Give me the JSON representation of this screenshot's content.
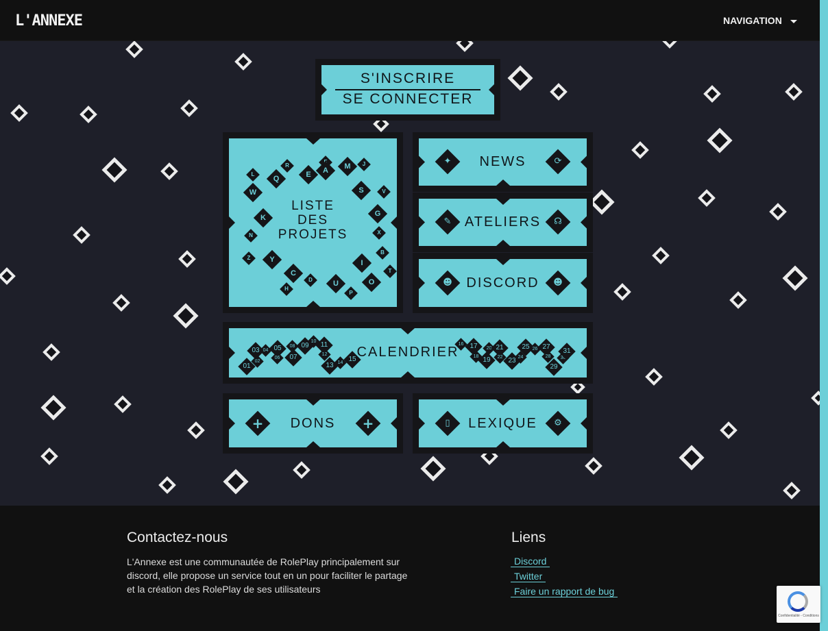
{
  "navbar": {
    "brand": "L'ANNEXE",
    "toggle_label": "NAVIGATION"
  },
  "auth": {
    "signup": "S'INSCRIRE",
    "login": "SE CONNECTER"
  },
  "tiles": {
    "projects": {
      "lines": [
        "LISTE",
        "DES",
        "PROJETS"
      ],
      "letters": [
        "L",
        "R",
        "F",
        "M",
        "J",
        "A",
        "Q",
        "E",
        "W",
        "S",
        "V",
        "K",
        "G",
        "N",
        "X",
        "Z",
        "Y",
        "B",
        "I",
        "T",
        "C",
        "D",
        "U",
        "O",
        "H",
        "P"
      ]
    },
    "news": {
      "label": "NEWS"
    },
    "ateliers": {
      "label": "ATELIERS"
    },
    "discord": {
      "label": "DISCORD"
    },
    "calendar": {
      "label": "CALENDRIER",
      "days": [
        "01",
        "02",
        "03",
        "04",
        "05",
        "06",
        "07",
        "08",
        "09",
        "10",
        "11",
        "12",
        "13",
        "14",
        "15",
        "16",
        "17",
        "18",
        "19",
        "20",
        "21",
        "22",
        "23",
        "24",
        "25",
        "26",
        "27",
        "28",
        "29",
        "30",
        "31"
      ]
    },
    "dons": {
      "label": "DONS"
    },
    "lexique": {
      "label": "LEXIQUE"
    }
  },
  "footer": {
    "contact_title": "Contactez-nous",
    "contact_text_1": "L'Annexe est une communautée de RolePlay principalement sur",
    "contact_text_2": "discord, elle propose un service tout en un pour faciliter le partage",
    "contact_text_3": "et la création des RolePlay de ses utilisateurs",
    "links_title": "Liens",
    "links": [
      "Discord",
      "Twitter",
      "Faire un rapport de bug"
    ]
  },
  "recaptcha": {
    "text": "Confidentialité - Conditions"
  },
  "colors": {
    "accent": "#6ccfd8",
    "background": "#1e1f29",
    "bar": "#111111"
  },
  "icons": {
    "news_left": "sparkle-icon",
    "news_right": "refresh-icon",
    "ateliers_left": "document-edit-icon",
    "ateliers_right": "headset-icon",
    "discord": "discord-icon",
    "dons": "plus-icon",
    "lexique_left": "book-icon",
    "lexique_right": "gear-icon"
  }
}
